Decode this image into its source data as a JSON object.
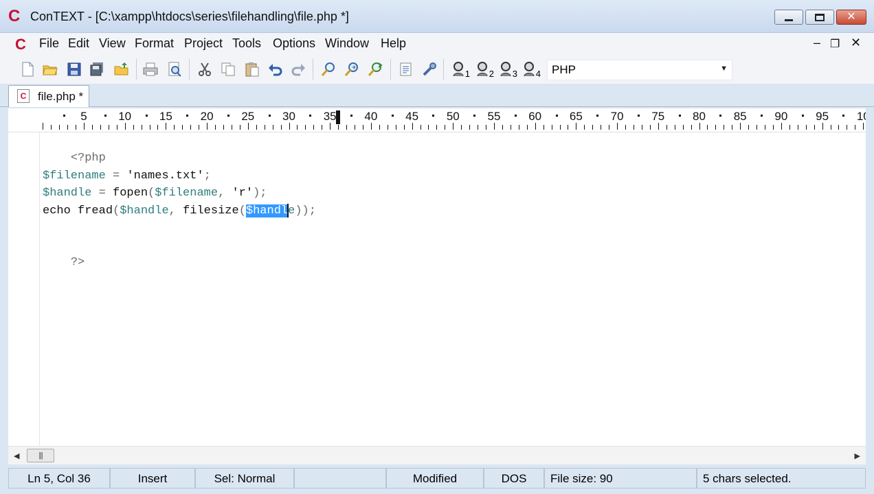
{
  "window": {
    "title": "ConTEXT - [C:\\xampp\\htdocs\\series\\filehandling\\file.php *]",
    "app_icon": "C"
  },
  "menu": {
    "items": [
      "File",
      "Edit",
      "View",
      "Format",
      "Project",
      "Tools",
      "Options",
      "Window",
      "Help"
    ]
  },
  "toolbar": {
    "icons": [
      "new-file-icon",
      "open-folder-icon",
      "save-icon",
      "save-all-icon",
      "open-folder-up-icon",
      "print-icon",
      "print-preview-icon",
      "cut-icon",
      "copy-icon",
      "paste-icon",
      "undo-icon",
      "redo-icon",
      "find-icon",
      "find-next-icon",
      "replace-icon",
      "export-icon",
      "tools-icon",
      "user-1-icon",
      "user-2-icon",
      "user-3-icon",
      "user-4-icon"
    ],
    "user_labels": [
      "1",
      "2",
      "3",
      "4"
    ],
    "language": "PHP"
  },
  "tabs": [
    {
      "label": "file.php *",
      "active": true
    }
  ],
  "ruler": {
    "labels": [
      "5",
      "10",
      "15",
      "20",
      "25",
      "30",
      "35",
      "40",
      "45",
      "50",
      "55",
      "60",
      "65",
      "70",
      "75",
      "80",
      "85",
      "90",
      "95",
      "10"
    ]
  },
  "editor": {
    "lines": [
      {
        "text": "<?php"
      },
      {
        "text": ""
      },
      {
        "parts": [
          "$filename",
          " = ",
          "'names.txt'",
          ";"
        ]
      },
      {
        "parts": [
          "$handle",
          " = ",
          "fopen",
          "(",
          "$filename",
          ", ",
          "'r'",
          ");"
        ]
      },
      {
        "parts": [
          "echo",
          " ",
          "fread",
          "(",
          "$handle",
          ", ",
          "filesize",
          "(",
          "$",
          "handl",
          "e",
          "));"
        ]
      },
      {
        "text": ""
      },
      {
        "text": "?>"
      }
    ]
  },
  "statusbar": {
    "position": "Ln 5, Col 36",
    "mode": "Insert",
    "sel": "Sel: Normal",
    "modified": "Modified",
    "format": "DOS",
    "file_size": "File size: 90",
    "selection": "5 chars selected."
  },
  "scrollbar": {
    "thumb_glyph": "|||"
  }
}
